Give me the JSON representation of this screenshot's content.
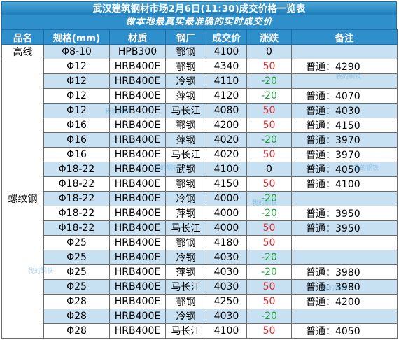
{
  "title": "武汉建筑钢材市场2月6日(11:30)成交价格一览表",
  "slogan": "做本地最真实最准确的实时成交价",
  "headers": [
    "品名",
    "规格(mm)",
    "材质",
    "钢厂",
    "成交价",
    "涨跌",
    "备注"
  ],
  "groups": [
    {
      "name": "高线",
      "rows": [
        {
          "spec": "Φ8-10",
          "grade": "HPB300",
          "mill": "鄂钢",
          "price": "4100",
          "change": "0",
          "dir": "flat",
          "note": ""
        }
      ]
    },
    {
      "name": "螺纹钢",
      "rows": [
        {
          "spec": "Φ12",
          "grade": "HRB400E",
          "mill": "鄂钢",
          "price": "4340",
          "change": "50",
          "dir": "up",
          "note": "普通：4290"
        },
        {
          "spec": "Φ12",
          "grade": "HRB400E",
          "mill": "冷钢",
          "price": "4110",
          "change": "-20",
          "dir": "down",
          "note": ""
        },
        {
          "spec": "Φ12",
          "grade": "HRB400E",
          "mill": "萍钢",
          "price": "4120",
          "change": "-20",
          "dir": "down",
          "note": "普通：4070"
        },
        {
          "spec": "Φ12",
          "grade": "HRB400E",
          "mill": "马长江",
          "price": "4080",
          "change": "50",
          "dir": "up",
          "note": "普通：4030"
        },
        {
          "spec": "Φ16",
          "grade": "HRB400E",
          "mill": "鄂钢",
          "price": "4200",
          "change": "50",
          "dir": "up",
          "note": "普通：4150"
        },
        {
          "spec": "Φ16",
          "grade": "HRB400E",
          "mill": "萍钢",
          "price": "4020",
          "change": "-20",
          "dir": "down",
          "note": "普通：3970"
        },
        {
          "spec": "Φ16",
          "grade": "HRB400E",
          "mill": "马长江",
          "price": "4020",
          "change": "50",
          "dir": "up",
          "note": "普通：3970"
        },
        {
          "spec": "Φ18-22",
          "grade": "HRB400E",
          "mill": "武钢",
          "price": "4100",
          "change": "0",
          "dir": "flat",
          "note": "普通：4050"
        },
        {
          "spec": "Φ18-22",
          "grade": "HRB400E",
          "mill": "鄂钢",
          "price": "4150",
          "change": "50",
          "dir": "up",
          "note": "普通：4100"
        },
        {
          "spec": "Φ18-22",
          "grade": "HRB400E",
          "mill": "冷钢",
          "price": "4000",
          "change": "-20",
          "dir": "down",
          "note": ""
        },
        {
          "spec": "Φ18-22",
          "grade": "HRB400E",
          "mill": "萍钢",
          "price": "4000",
          "change": "-20",
          "dir": "down",
          "note": "普通：3950"
        },
        {
          "spec": "Φ18-22",
          "grade": "HRB400E",
          "mill": "马长江",
          "price": "4000",
          "change": "50",
          "dir": "up",
          "note": "普通：3950"
        },
        {
          "spec": "Φ25",
          "grade": "HRB400E",
          "mill": "鄂钢",
          "price": "4180",
          "change": "50",
          "dir": "up",
          "note": ""
        },
        {
          "spec": "Φ25",
          "grade": "HRB400E",
          "mill": "冷钢",
          "price": "4030",
          "change": "-20",
          "dir": "down",
          "note": ""
        },
        {
          "spec": "Φ25",
          "grade": "HRB400E",
          "mill": "萍钢",
          "price": "4030",
          "change": "-20",
          "dir": "down",
          "note": "普通：3980"
        },
        {
          "spec": "Φ25",
          "grade": "HRB400E",
          "mill": "马长江",
          "price": "4030",
          "change": "50",
          "dir": "up",
          "note": "普通：3980"
        },
        {
          "spec": "Φ28",
          "grade": "HRB400E",
          "mill": "鄂钢",
          "price": "4250",
          "change": "50",
          "dir": "up",
          "note": "普通：4200"
        },
        {
          "spec": "Φ28",
          "grade": "HRB400E",
          "mill": "冷钢",
          "price": "4030",
          "change": "-20",
          "dir": "down",
          "note": ""
        },
        {
          "spec": "Φ28",
          "grade": "HRB400E",
          "mill": "马长江",
          "price": "4100",
          "change": "50",
          "dir": "up",
          "note": "普通：4050"
        }
      ]
    }
  ],
  "colors": {
    "header_blue": "#2f8fca",
    "row_tint": "#c8e1f2",
    "up": "#e0262b",
    "down": "#1e9a3a"
  },
  "watermark": "我的钢铁"
}
